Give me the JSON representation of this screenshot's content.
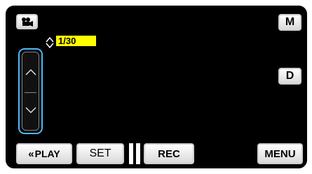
{
  "top_left": {
    "mode_icon": "movie-camera-icon"
  },
  "shutter": {
    "value": "1/30",
    "arrow_icon": "up-down-arrow-icon"
  },
  "right_controls": {
    "m_label": "M",
    "d_label": "D"
  },
  "slider": {
    "up_icon": "chevron-up-icon",
    "down_icon": "chevron-down-icon",
    "highlight_color": "#4db8ff"
  },
  "bottom_bar": {
    "play_label": "PLAY",
    "play_icon": "double-chevron-left-icon",
    "set_label": "SET",
    "pause_icon": "pause-icon",
    "rec_label": "REC",
    "menu_label": "MENU"
  },
  "colors": {
    "background": "#000000",
    "shutter_highlight": "#ffff00"
  }
}
